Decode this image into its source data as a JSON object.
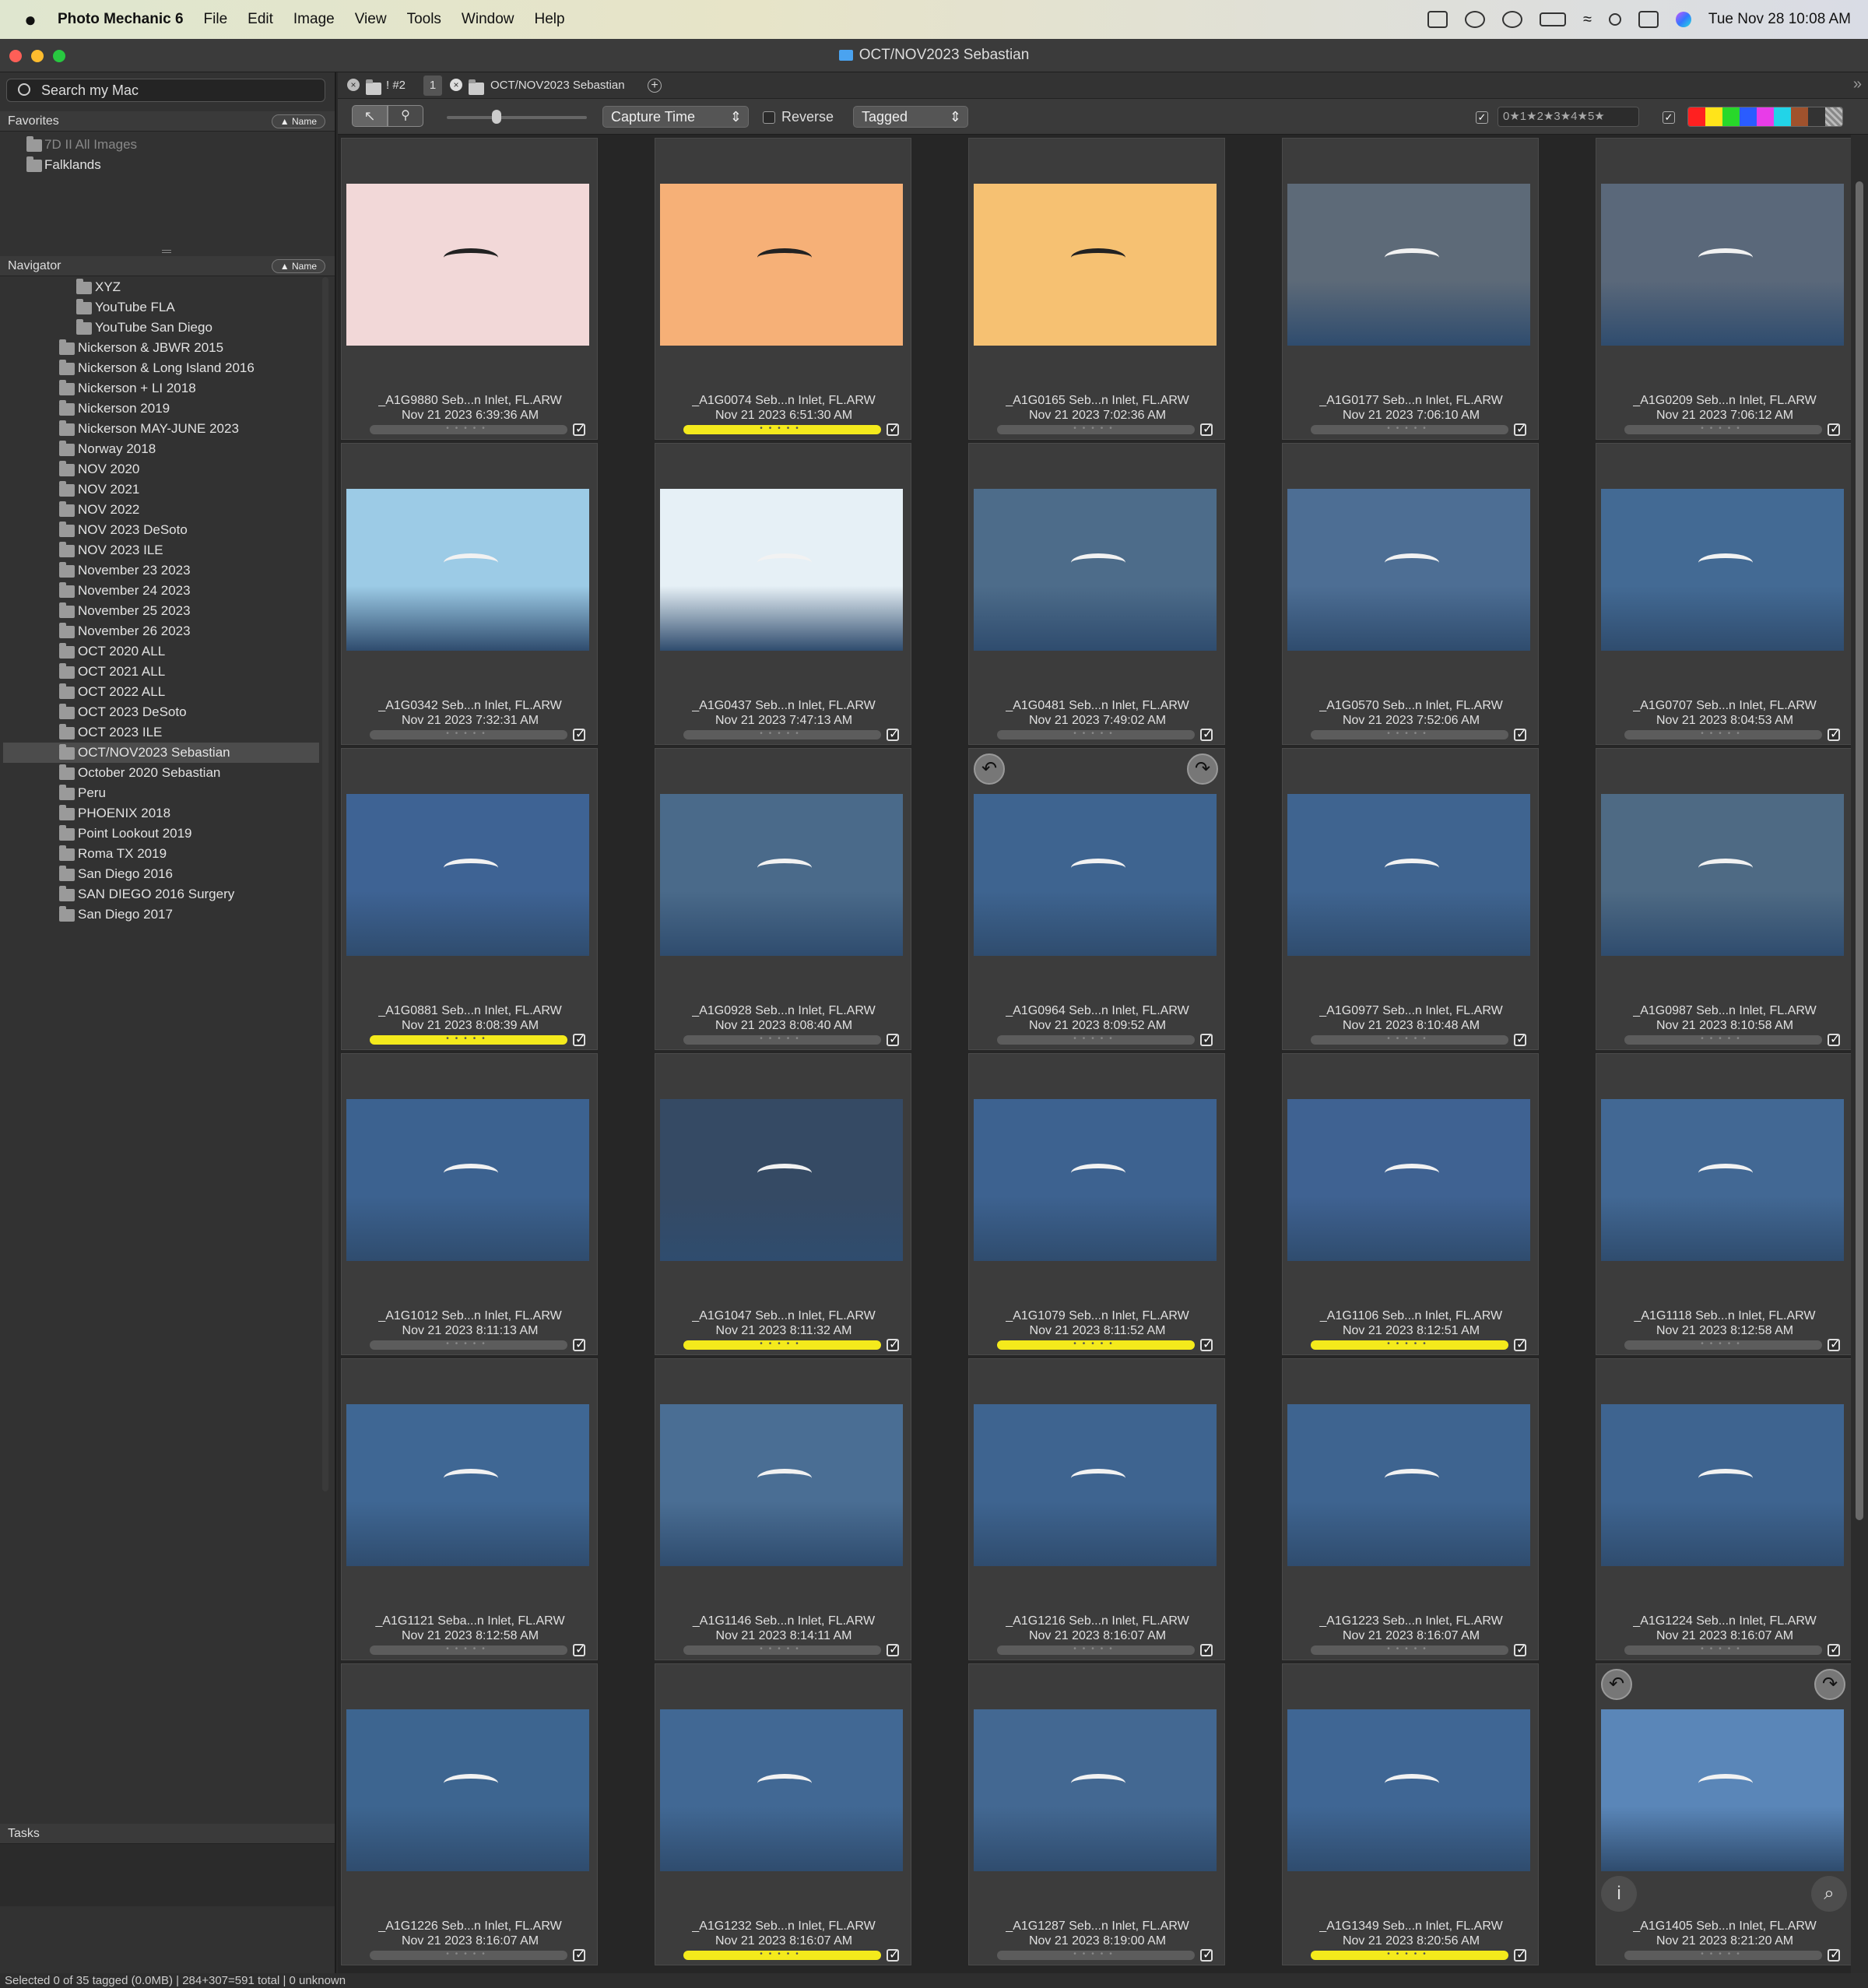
{
  "menubar": {
    "app": "Photo Mechanic 6",
    "menus": [
      "File",
      "Edit",
      "Image",
      "View",
      "Tools",
      "Window",
      "Help"
    ],
    "clock": "Tue Nov 28  10:08 AM"
  },
  "window": {
    "title": "OCT/NOV2023 Sebastian"
  },
  "sidebar": {
    "search_placeholder": "Search my Mac",
    "favorites_label": "Favorites",
    "sort_label": "▲ Name",
    "favorites": [
      "7D II All Images",
      "Falklands"
    ],
    "navigator_label": "Navigator",
    "nav_items": [
      "XYZ",
      "YouTube FLA",
      "YouTube San Diego",
      "Nickerson & JBWR 2015",
      "Nickerson & Long Island 2016",
      "Nickerson + LI 2018",
      "Nickerson 2019",
      "Nickerson MAY-JUNE 2023",
      "Norway 2018",
      "NOV 2020",
      "NOV 2021",
      "NOV 2022",
      "NOV 2023 DeSoto",
      "NOV 2023 ILE",
      "November 23 2023",
      "November 24 2023",
      "November 25 2023",
      "November 26 2023",
      "OCT 2020 ALL",
      "OCT 2021 ALL",
      "OCT 2022 ALL",
      "OCT 2023 DeSoto",
      "OCT 2023 ILE",
      "OCT/NOV2023 Sebastian",
      "October 2020 Sebastian",
      "Peru",
      "PHOENIX 2018",
      "Point Lookout 2019",
      "Roma TX 2019",
      "San Diego 2016",
      "SAN DIEGO 2016 Surgery",
      "San Diego 2017"
    ],
    "tasks_label": "Tasks"
  },
  "tabs": {
    "tab1": "! #2",
    "tab1_count": "1",
    "tab2": "OCT/NOV2023 Sebastian"
  },
  "toolbar": {
    "sort": "Capture Time",
    "reverse": "Reverse",
    "filter": "Tagged",
    "rating_filter": "0★1★2★3★4★5★"
  },
  "thumbs": [
    {
      "name": "_A1G9880   Seb...n Inlet, FL.ARW",
      "date": "Nov 21 2023 6:39:36 AM",
      "tagged": false
    },
    {
      "name": "_A1G0074   Seb...n Inlet, FL.ARW",
      "date": "Nov 21 2023 6:51:30 AM",
      "tagged": true
    },
    {
      "name": "_A1G0165   Seb...n Inlet, FL.ARW",
      "date": "Nov 21 2023 7:02:36 AM",
      "tagged": false
    },
    {
      "name": "_A1G0177   Seb...n Inlet, FL.ARW",
      "date": "Nov 21 2023 7:06:10 AM",
      "tagged": false
    },
    {
      "name": "_A1G0209   Seb...n Inlet, FL.ARW",
      "date": "Nov 21 2023 7:06:12 AM",
      "tagged": false
    },
    {
      "name": "_A1G0342   Seb...n Inlet, FL.ARW",
      "date": "Nov 21 2023 7:32:31 AM",
      "tagged": false
    },
    {
      "name": "_A1G0437   Seb...n Inlet, FL.ARW",
      "date": "Nov 21 2023 7:47:13 AM",
      "tagged": false
    },
    {
      "name": "_A1G0481   Seb...n Inlet, FL.ARW",
      "date": "Nov 21 2023 7:49:02 AM",
      "tagged": false
    },
    {
      "name": "_A1G0570   Seb...n Inlet, FL.ARW",
      "date": "Nov 21 2023 7:52:06 AM",
      "tagged": false
    },
    {
      "name": "_A1G0707   Seb...n Inlet, FL.ARW",
      "date": "Nov 21 2023 8:04:53 AM",
      "tagged": false
    },
    {
      "name": "_A1G0881   Seb...n Inlet, FL.ARW",
      "date": "Nov 21 2023 8:08:39 AM",
      "tagged": true
    },
    {
      "name": "_A1G0928   Seb...n Inlet, FL.ARW",
      "date": "Nov 21 2023 8:08:40 AM",
      "tagged": false
    },
    {
      "name": "_A1G0964   Seb...n Inlet, FL.ARW",
      "date": "Nov 21 2023 8:09:52 AM",
      "tagged": false
    },
    {
      "name": "_A1G0977   Seb...n Inlet, FL.ARW",
      "date": "Nov 21 2023 8:10:48 AM",
      "tagged": false
    },
    {
      "name": "_A1G0987   Seb...n Inlet, FL.ARW",
      "date": "Nov 21 2023 8:10:58 AM",
      "tagged": false
    },
    {
      "name": "_A1G1012   Seb...n Inlet, FL.ARW",
      "date": "Nov 21 2023 8:11:13 AM",
      "tagged": false
    },
    {
      "name": "_A1G1047   Seb...n Inlet, FL.ARW",
      "date": "Nov 21 2023 8:11:32 AM",
      "tagged": true
    },
    {
      "name": "_A1G1079   Seb...n Inlet, FL.ARW",
      "date": "Nov 21 2023 8:11:52 AM",
      "tagged": true
    },
    {
      "name": "_A1G1106   Seb...n Inlet, FL.ARW",
      "date": "Nov 21 2023 8:12:51 AM",
      "tagged": true
    },
    {
      "name": "_A1G1118   Seb...n Inlet, FL.ARW",
      "date": "Nov 21 2023 8:12:58 AM",
      "tagged": false
    },
    {
      "name": "_A1G1121   Seba...n Inlet, FL.ARW",
      "date": "Nov 21 2023 8:12:58 AM",
      "tagged": false
    },
    {
      "name": "_A1G1146   Seb...n Inlet, FL.ARW",
      "date": "Nov 21 2023 8:14:11 AM",
      "tagged": false
    },
    {
      "name": "_A1G1216   Seb...n Inlet, FL.ARW",
      "date": "Nov 21 2023 8:16:07 AM",
      "tagged": false
    },
    {
      "name": "_A1G1223   Seb...n Inlet, FL.ARW",
      "date": "Nov 21 2023 8:16:07 AM",
      "tagged": false
    },
    {
      "name": "_A1G1224   Seb...n Inlet, FL.ARW",
      "date": "Nov 21 2023 8:16:07 AM",
      "tagged": false
    },
    {
      "name": "_A1G1226   Seb...n Inlet, FL.ARW",
      "date": "Nov 21 2023 8:16:07 AM",
      "tagged": false
    },
    {
      "name": "_A1G1232   Seb...n Inlet, FL.ARW",
      "date": "Nov 21 2023 8:16:07 AM",
      "tagged": true
    },
    {
      "name": "_A1G1287   Seb...n Inlet, FL.ARW",
      "date": "Nov 21 2023 8:19:00 AM",
      "tagged": false
    },
    {
      "name": "_A1G1349   Seb...n Inlet, FL.ARW",
      "date": "Nov 21 2023 8:20:56 AM",
      "tagged": true
    },
    {
      "name": "_A1G1405   Seb...n Inlet, FL.ARW",
      "date": "Nov 21 2023 8:21:20 AM",
      "tagged": false
    }
  ],
  "thumb_colors": [
    "#f2d8d8",
    "#f6b077",
    "#f6c172",
    "#5d6a78",
    "#5a687a",
    "#9ccbe6",
    "#e6f0f6",
    "#4d6c8a",
    "#4d6e94",
    "#436a94",
    "#3e6394",
    "#4a6a8a",
    "#3e6490",
    "#3f6490",
    "#4e6a84",
    "#3c6290",
    "#354a64",
    "#3d6290",
    "#3f6292",
    "#426894",
    "#3f6794",
    "#4a6e94",
    "#3e6490",
    "#3e6490",
    "#3e6490",
    "#3d6590",
    "#416894",
    "#436892",
    "#3f6694",
    "#5a86b8"
  ],
  "status": "Selected 0 of 35 tagged (0.0MB) | 284+307=591 total | 0 unknown"
}
